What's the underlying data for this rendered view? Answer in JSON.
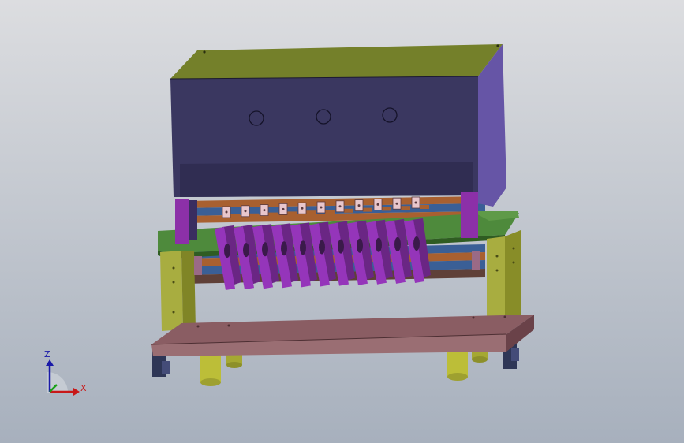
{
  "triad": {
    "z_label": "Z",
    "x_label": "X",
    "z_color": "#1a1aa8",
    "x_color": "#c81818",
    "y_color": "#18a018"
  },
  "model": {
    "icon": "cad-assembly-model",
    "colors": {
      "background_top": "#dcdde0",
      "background_bottom": "#a7b0bd",
      "housing_front": "#3a3760",
      "housing_side": "#6655a6",
      "housing_top": "#74802a",
      "frame_olive": "#a8ad40",
      "frame_green": "#4e8a3c",
      "fingers_purple": "#9535ba",
      "base_plate": "#8a5d63",
      "feet_yellow": "#bcbe38",
      "rod_blue": "#3a5f96",
      "rod_orange": "#a86030",
      "clip_pink": "#e8c6cc"
    }
  }
}
